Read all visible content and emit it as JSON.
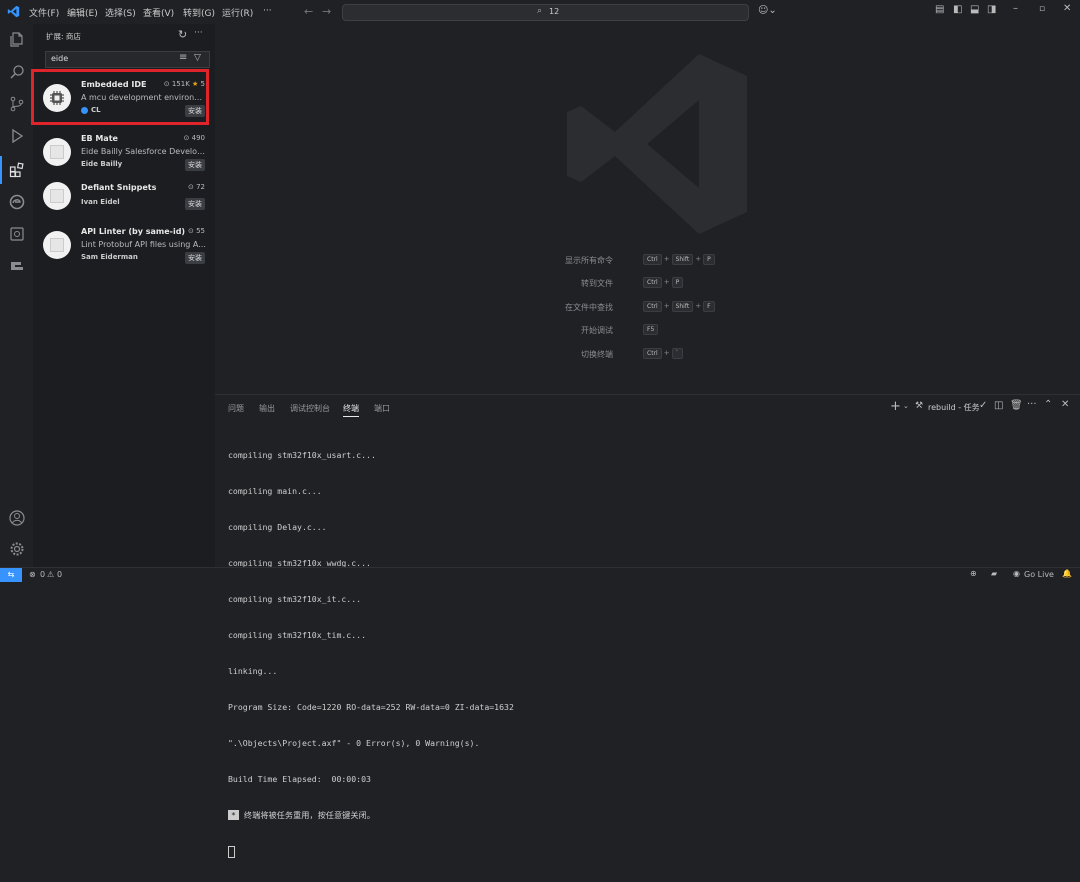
{
  "titlebar": {
    "menus": [
      "文件(F)",
      "编辑(E)",
      "选择(S)",
      "查看(V)",
      "转到(G)",
      "运行(R)",
      "···"
    ],
    "search": "12"
  },
  "sidebar": {
    "header": "扩展: 商店",
    "search_value": "eide",
    "extensions": [
      {
        "name": "Embedded IDE",
        "desc": "A mcu development environm...",
        "publisher": "CL",
        "downloads": "151K",
        "rating": "5",
        "install": "安装"
      },
      {
        "name": "EB Mate",
        "desc": "Eide Bailly Salesforce Develop...",
        "publisher": "Eide Bailly",
        "downloads": "490",
        "install": "安装"
      },
      {
        "name": "Defiant Snippets",
        "desc": "",
        "publisher": "Ivan Eidel",
        "downloads": "72",
        "install": "安装"
      },
      {
        "name": "API Linter (by same-id)",
        "desc": "Lint Protobuf API files using A...",
        "publisher": "Sam Eiderman",
        "downloads": "55",
        "install": "安装"
      }
    ]
  },
  "editor": {
    "shortcuts": [
      {
        "label": "显示所有命令",
        "keys": [
          "Ctrl",
          "Shift",
          "P"
        ]
      },
      {
        "label": "转到文件",
        "keys": [
          "Ctrl",
          "P"
        ]
      },
      {
        "label": "在文件中查找",
        "keys": [
          "Ctrl",
          "Shift",
          "F"
        ]
      },
      {
        "label": "开始调试",
        "keys": [
          "F5"
        ]
      },
      {
        "label": "切换终端",
        "keys": [
          "Ctrl",
          "`"
        ]
      }
    ]
  },
  "panel": {
    "tabs": [
      "问题",
      "输出",
      "调试控制台",
      "终端",
      "端口"
    ],
    "active_tab": "终端",
    "task": "rebuild - 任务",
    "terminal_lines": [
      "compiling stm32f10x_usart.c...",
      "compiling main.c...",
      "compiling Delay.c...",
      "compiling stm32f10x_wwdg.c...",
      "compiling stm32f10x_it.c...",
      "compiling stm32f10x_tim.c...",
      "linking...",
      "Program Size: Code=1220 RO-data=252 RW-data=0 ZI-data=1632",
      "\".\\Objects\\Project.axf\" - 0 Error(s), 0 Warning(s).",
      "Build Time Elapsed:  00:00:03"
    ],
    "reuse_badge": "*",
    "reuse_text": "终端将被任务重用，按任意键关闭。"
  },
  "status": {
    "errors": "0",
    "warnings": "0",
    "golive": "Go Live"
  },
  "colors": {
    "highlight": "#e0242b",
    "accent": "#3794ff"
  }
}
